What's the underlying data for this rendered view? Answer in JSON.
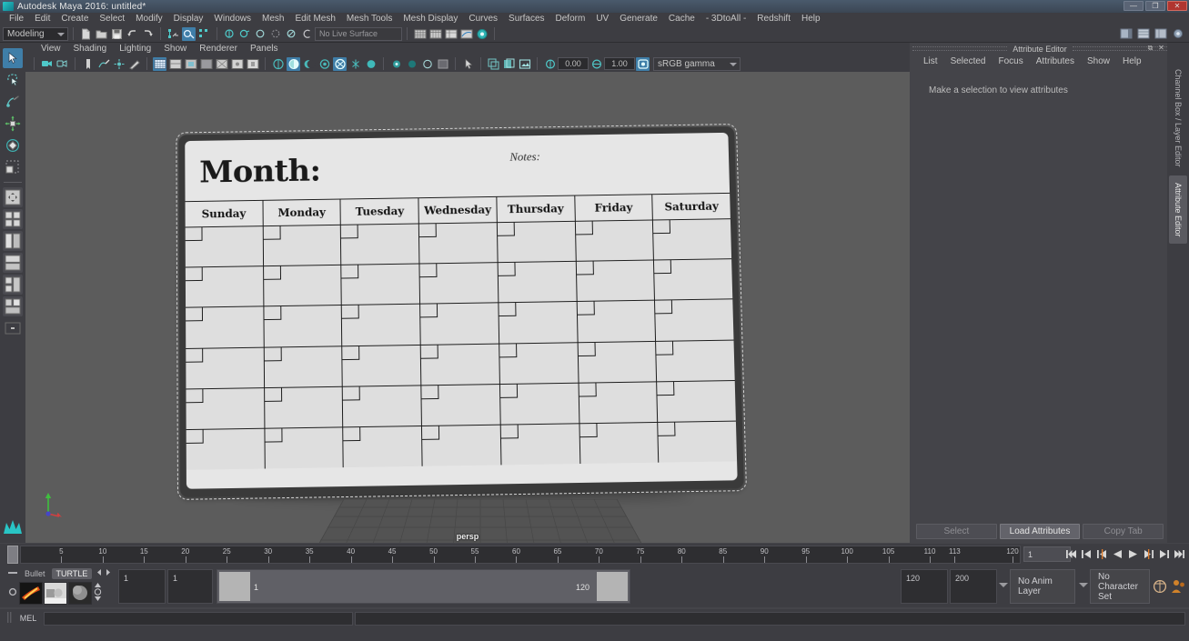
{
  "window": {
    "title": "Autodesk Maya 2016: untitled*",
    "minimize": "—",
    "maximize": "❐",
    "close": "✕"
  },
  "menubar": {
    "items": [
      "File",
      "Edit",
      "Create",
      "Select",
      "Modify",
      "Display",
      "Windows",
      "Mesh",
      "Edit Mesh",
      "Mesh Tools",
      "Mesh Display",
      "Curves",
      "Surfaces",
      "Deform",
      "UV",
      "Generate",
      "Cache",
      "- 3DtoAll -",
      "Redshift",
      "Help"
    ]
  },
  "statusline": {
    "menuset": "Modeling",
    "live_surface": "No Live Surface"
  },
  "viewport_panel": {
    "menus": [
      "View",
      "Shading",
      "Lighting",
      "Show",
      "Renderer",
      "Panels"
    ],
    "exposure_value": "0.00",
    "gamma_value": "1.00",
    "color_space": "sRGB gamma",
    "camera_label": "persp"
  },
  "model": {
    "title": "Month:",
    "notes_label": "Notes:",
    "days": [
      "Sunday",
      "Monday",
      "Tuesday",
      "Wednesday",
      "Thursday",
      "Friday",
      "Saturday"
    ],
    "week_rows": 6
  },
  "attribute_editor": {
    "panel_title": "Attribute Editor",
    "menus": [
      "List",
      "Selected",
      "Focus",
      "Attributes",
      "Show",
      "Help"
    ],
    "empty_message": "Make a selection to view attributes",
    "buttons": {
      "select": "Select",
      "load_attributes": "Load Attributes",
      "copy_tab": "Copy Tab"
    },
    "float_icon": "⧉",
    "close_icon": "✕"
  },
  "dock_tabs": {
    "channel_box": "Channel Box / Layer Editor",
    "attribute_editor": "Attribute Editor"
  },
  "timeline": {
    "ticks": [
      5,
      10,
      15,
      20,
      25,
      30,
      35,
      40,
      45,
      50,
      55,
      60,
      65,
      70,
      75,
      80,
      85,
      90,
      95,
      100,
      105,
      110,
      113,
      120
    ],
    "start": 1,
    "end": 120,
    "current_frame": "1",
    "playback_buttons": [
      "go-to-start",
      "step-back-key",
      "step-back-frame",
      "play-backwards",
      "play-forwards",
      "step-forward-frame",
      "step-forward-key",
      "go-to-end"
    ]
  },
  "rangeslider": {
    "shelf_tabs": [
      "Bullet",
      "TURTLE"
    ],
    "shelf_active": "TURTLE",
    "anim_start": "1",
    "anim_start_inner": "1",
    "range_start": "1",
    "range_end": "120",
    "range_end_field": "120",
    "anim_end": "200",
    "anim_layer": "No Anim Layer",
    "character_set": "No Character Set"
  },
  "command_line": {
    "label": "MEL",
    "input_value": "",
    "output_value": ""
  }
}
